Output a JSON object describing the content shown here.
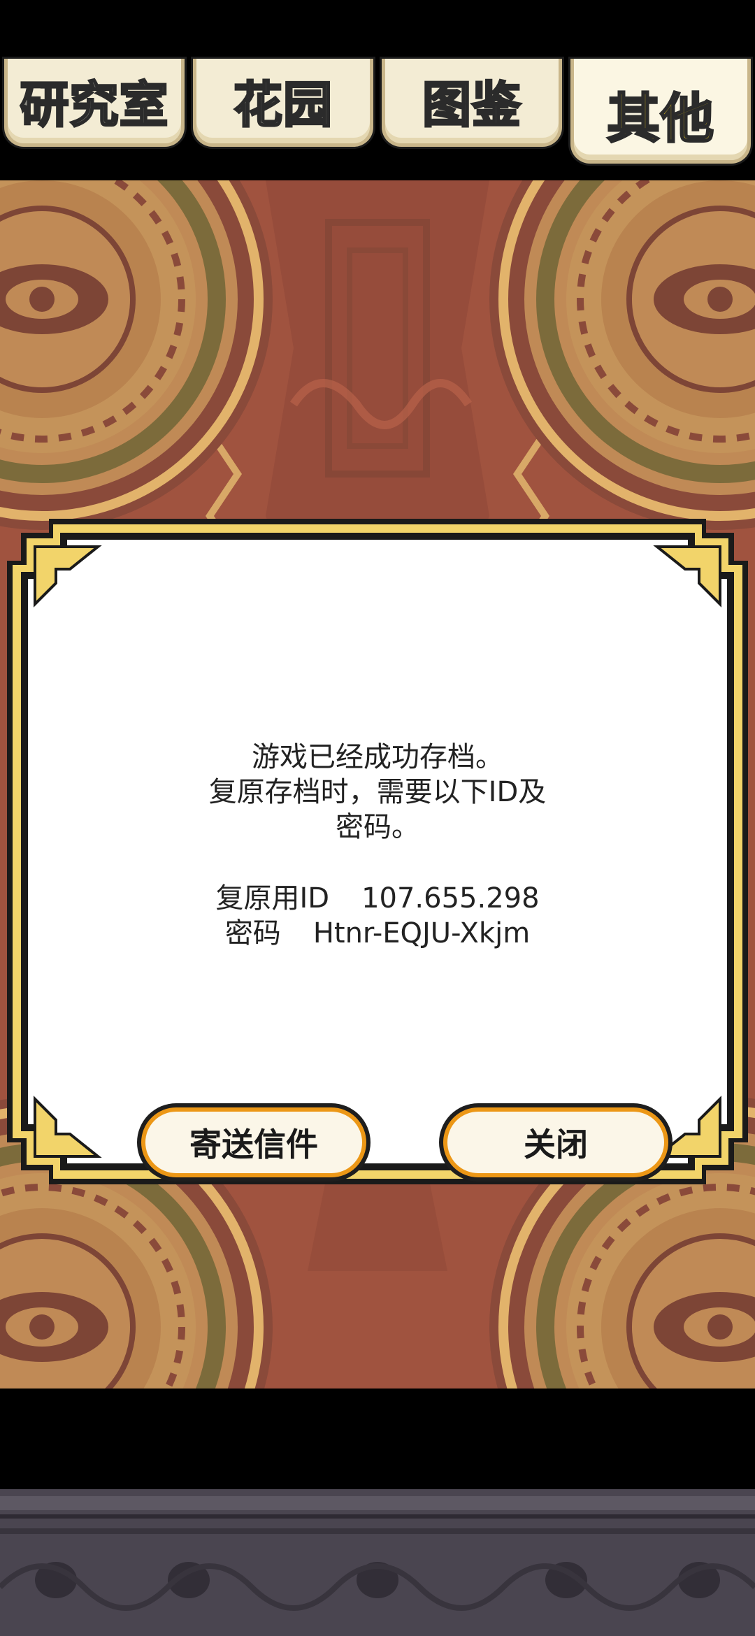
{
  "tabs": [
    {
      "label": "研究室",
      "active": false
    },
    {
      "label": "花园",
      "active": false
    },
    {
      "label": "图鉴",
      "active": false
    },
    {
      "label": "其他",
      "active": true
    }
  ],
  "dialog": {
    "message_lines": [
      "游戏已经成功存档。",
      "复原存档时，需要以下ID及",
      "密码。"
    ],
    "id_label": "复原用ID",
    "id_value": "107.655.298",
    "password_label": "密码",
    "password_value": "Htnr-EQJU-Xkjm",
    "send_button": "寄送信件",
    "close_button": "关闭"
  },
  "colors": {
    "background_red": "#a0533f",
    "pattern_brown": "#c08a56",
    "frame_gold": "#f2d46a",
    "button_orange": "#ec9716",
    "tab_active_text": "#f5d11c"
  }
}
